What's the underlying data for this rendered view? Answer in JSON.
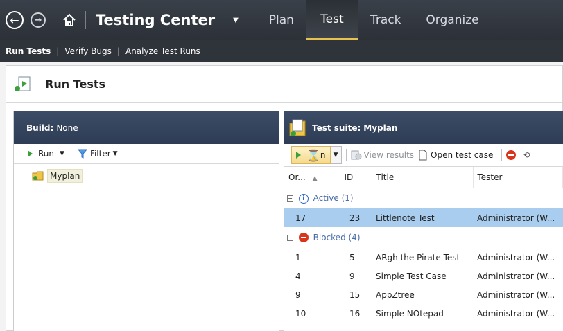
{
  "nav": {
    "app_title": "Testing Center",
    "tabs": [
      "Plan",
      "Test",
      "Track",
      "Organize"
    ],
    "active_tab": "Test"
  },
  "subnav": {
    "items": [
      "Run Tests",
      "Verify Bugs",
      "Analyze Test Runs"
    ]
  },
  "page": {
    "title": "Run Tests"
  },
  "left_pane": {
    "build_label": "Build:",
    "build_value": "None",
    "run_label": "Run",
    "filter_label": "Filter",
    "tree_item": "Myplan"
  },
  "right_pane": {
    "suite_label": "Test suite:",
    "suite_value": "Myplan",
    "run_label": "n",
    "view_results": "View results",
    "open_test_case": "Open test case",
    "columns": [
      "Or...",
      "ID",
      "Title",
      "Tester"
    ],
    "groups": [
      {
        "label": "Active (1)",
        "status": "active",
        "rows": [
          {
            "order": "17",
            "id": "23",
            "title": "Littlenote Test",
            "tester": "Administrator (W...",
            "selected": true
          }
        ]
      },
      {
        "label": "Blocked (4)",
        "status": "blocked",
        "rows": [
          {
            "order": "1",
            "id": "5",
            "title": "ARgh the Pirate Test",
            "tester": "Administrator (W..."
          },
          {
            "order": "4",
            "id": "9",
            "title": "Simple Test Case",
            "tester": "Administrator (W..."
          },
          {
            "order": "9",
            "id": "15",
            "title": "AppZtree",
            "tester": "Administrator (W..."
          },
          {
            "order": "10",
            "id": "16",
            "title": "Simple NOtepad",
            "tester": "Administrator (W..."
          }
        ]
      }
    ]
  },
  "colors": {
    "nav_bg": "#2c3138",
    "active_tab_underline": "#e8c24e",
    "pane_header_bg": "#2e3d55",
    "selected_row": "#a9cdee",
    "blocked_red": "#d8361c"
  }
}
